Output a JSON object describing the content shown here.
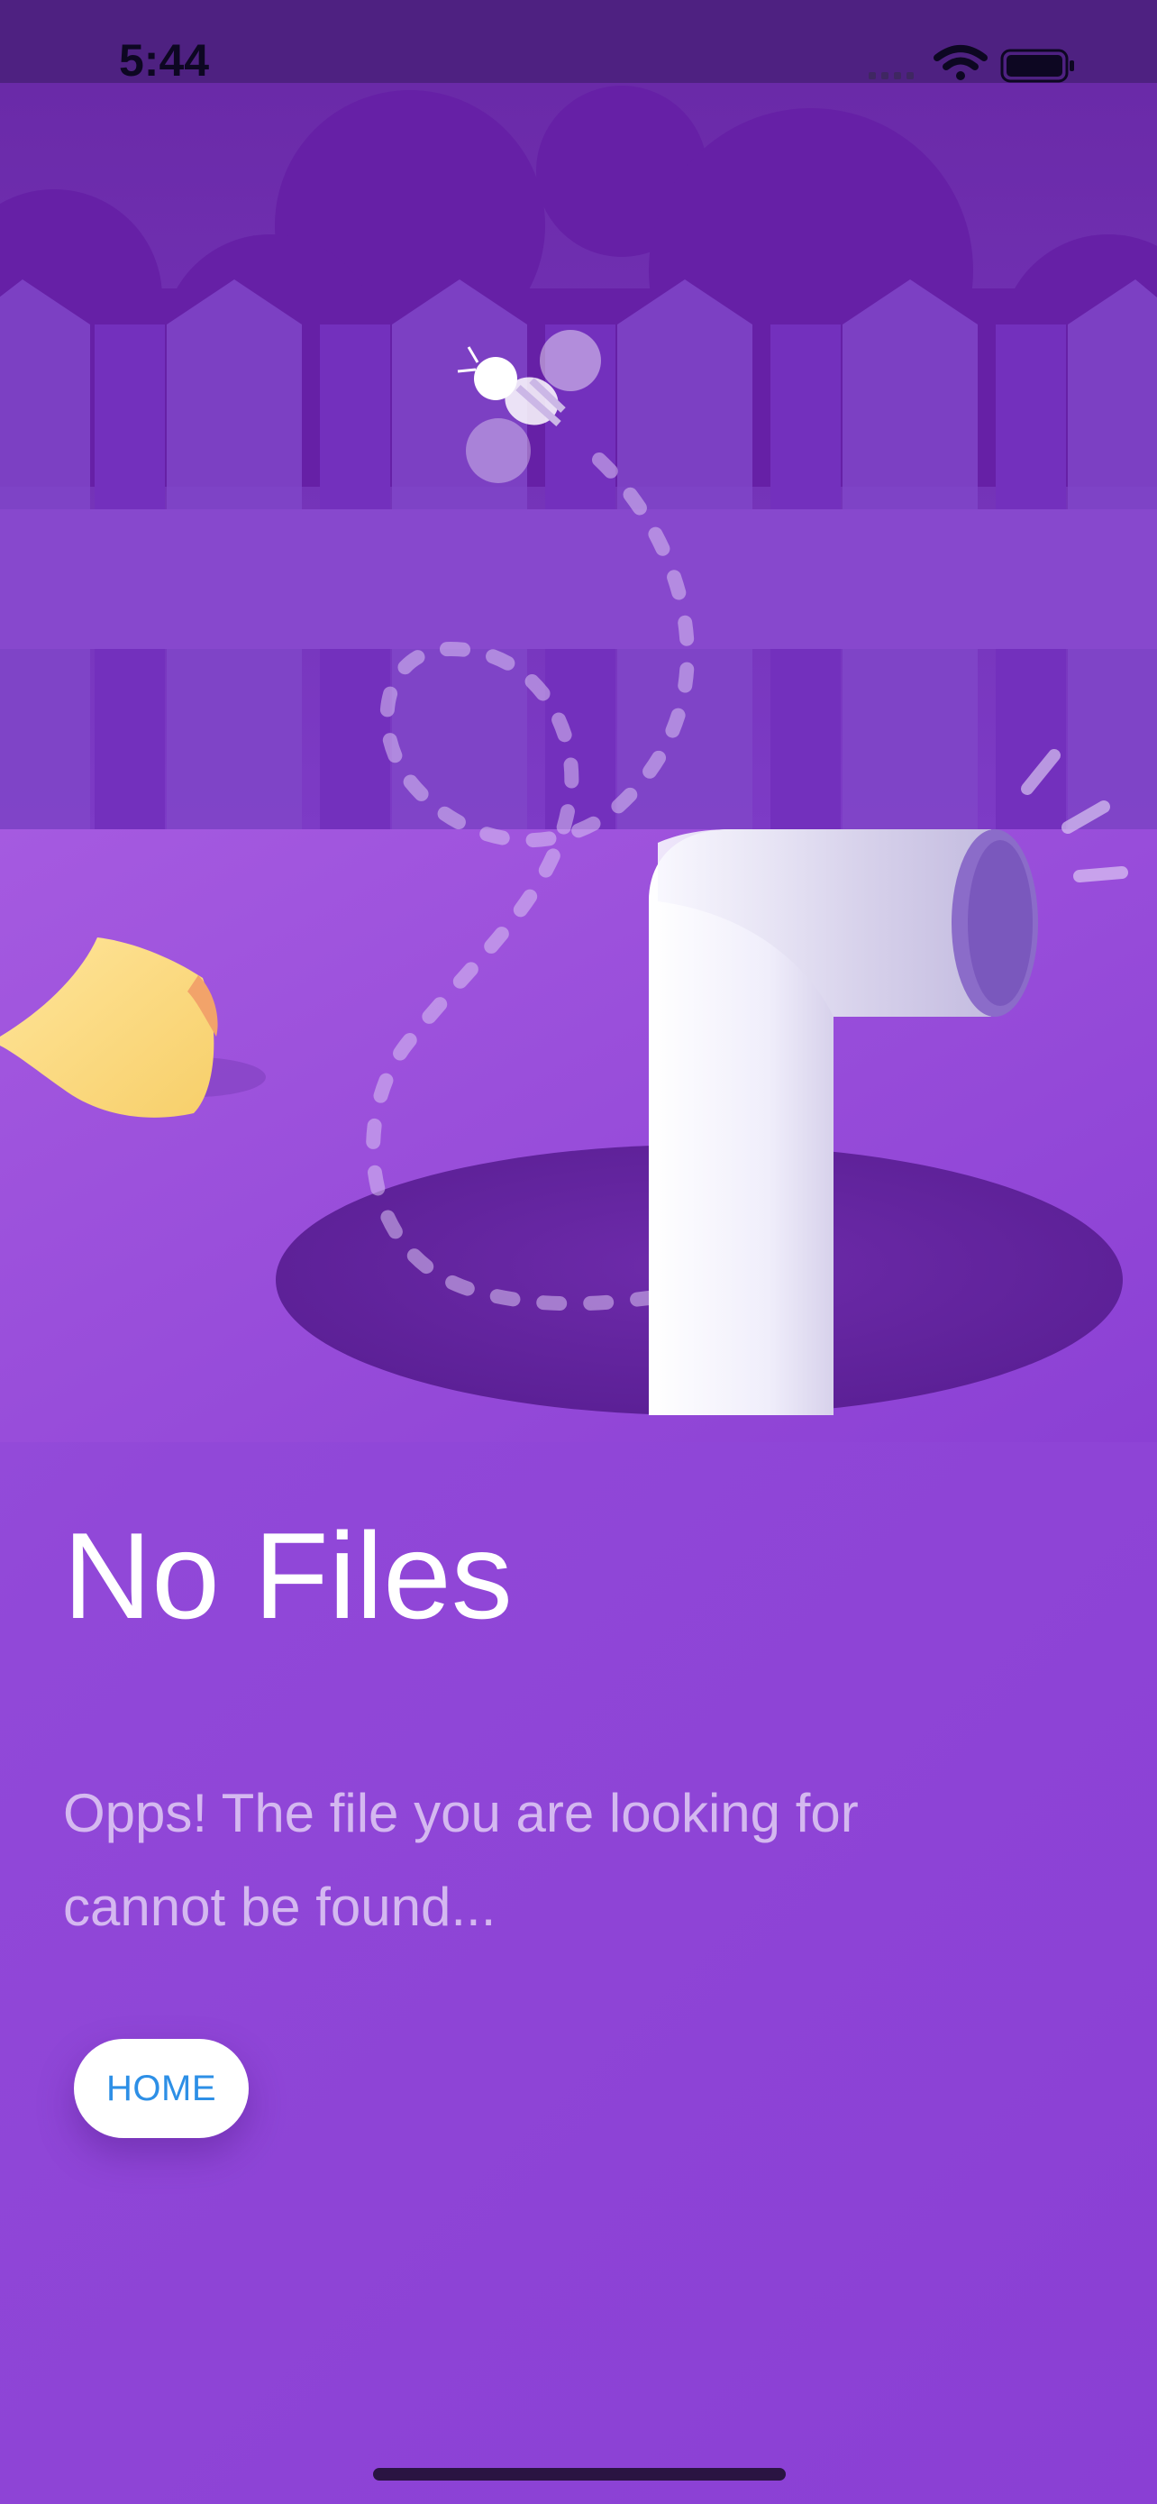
{
  "status_bar": {
    "time": "5:44",
    "icons": [
      "cellular-signal-icon",
      "wifi-icon",
      "battery-icon"
    ]
  },
  "illustration": {
    "elements": [
      "cloud-icon",
      "fence-icon",
      "bee-icon",
      "flight-path-icon",
      "paper-note-icon",
      "pipe-icon",
      "hole-icon"
    ]
  },
  "empty_state": {
    "title": "No Files",
    "message": "Opps! The file you are looking for cannot be found...",
    "home_label": "HOME"
  },
  "colors": {
    "background": "#9148d8",
    "status_bar": "#4e2181",
    "title": "#ffffff",
    "button_text": "#2d8fe6",
    "button_bg": "#ffffff"
  }
}
